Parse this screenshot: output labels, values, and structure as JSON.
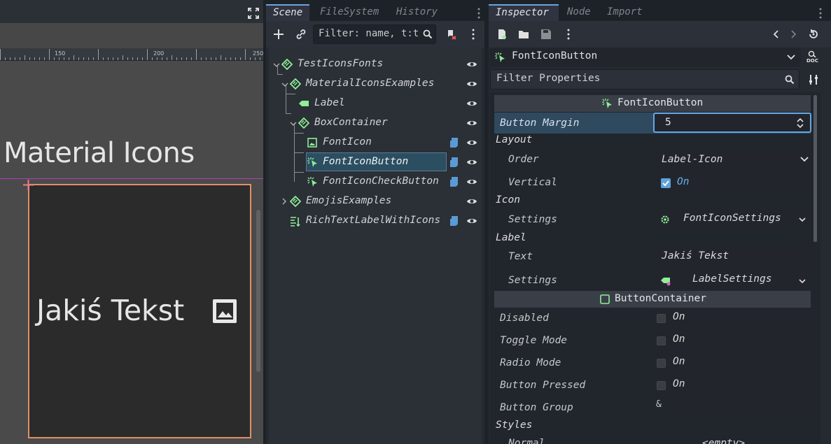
{
  "viewport": {
    "ruler_labels": [
      "150",
      "200",
      "250"
    ],
    "title_text": "Material Icons",
    "button_text": "Jakiś Tekst",
    "image_icon": "image-icon",
    "maximize_icon": "maximize-icon"
  },
  "scene_dock": {
    "tabs": [
      "Scene",
      "FileSystem",
      "History"
    ],
    "filter_placeholder": "Filter: name, t:t",
    "tree": [
      {
        "label": "TestIconsFonts",
        "icon": "node2d-icon"
      },
      {
        "label": "MaterialIconsExamples",
        "icon": "node2d-icon"
      },
      {
        "label": "Label",
        "icon": "label-icon"
      },
      {
        "label": "BoxContainer",
        "icon": "node2d-icon"
      },
      {
        "label": "FontIcon",
        "icon": "texture-icon"
      },
      {
        "label": "FontIconButton",
        "icon": "button-icon"
      },
      {
        "label": "FontIconCheckButton",
        "icon": "button-icon"
      },
      {
        "label": "EmojisExamples",
        "icon": "node2d-icon"
      },
      {
        "label": "RichTextLabelWithIcons",
        "icon": "richtext-icon"
      }
    ]
  },
  "inspector": {
    "tabs": [
      "Inspector",
      "Node",
      "Import"
    ],
    "node_name": "FontIconButton",
    "filter_placeholder": "Filter Properties",
    "doc_label": "DOC",
    "category_main": "FontIconButton",
    "button_margin_label": "Button Margin",
    "button_margin_value": "5",
    "layout": {
      "title": "Layout",
      "order_label": "Order",
      "order_value": "Label-Icon",
      "vertical_label": "Vertical",
      "vertical_value": "On"
    },
    "icon": {
      "title": "Icon",
      "settings_label": "Settings",
      "settings_value": "FontIconSettings"
    },
    "label": {
      "title": "Label",
      "text_label": "Text",
      "text_value": "Jakiś Tekst",
      "settings_label": "Settings",
      "settings_value": "LabelSettings"
    },
    "category_container": "ButtonContainer",
    "props": [
      {
        "label": "Disabled",
        "value": "On"
      },
      {
        "label": "Toggle Mode",
        "value": "On"
      },
      {
        "label": "Radio Mode",
        "value": "On"
      },
      {
        "label": "Button Pressed",
        "value": "On"
      }
    ],
    "button_group_label": "Button Group",
    "button_group_prefix": "&",
    "styles_title": "Styles",
    "normal_label": "Normal",
    "normal_value": "<empty>"
  },
  "colors": {
    "accent": "#6fa3d9",
    "selection": "#2c4e61",
    "green_icon": "#8eef97",
    "script_blue": "#5a9bd6",
    "guide_magenta": "#b33fbb",
    "box_border": "#e28f66"
  }
}
